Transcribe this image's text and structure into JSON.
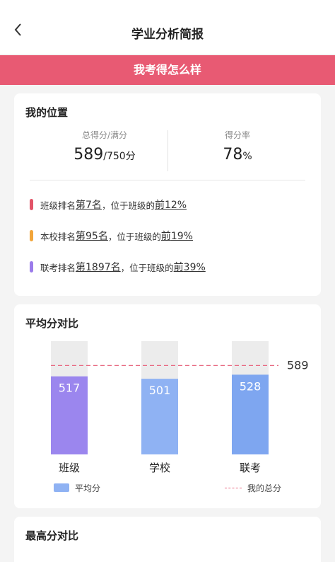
{
  "header": {
    "title": "学业分析简报",
    "back_icon": "chevron-left-icon"
  },
  "banner": {
    "text": "我考得怎么样"
  },
  "position_card": {
    "title": "我的位置",
    "score_label": "总得分/满分",
    "score": "589",
    "score_total": "/750分",
    "rate_label": "得分率",
    "rate": "78",
    "rate_unit": "%",
    "rankings": [
      {
        "color": "#e25468",
        "prefix": "班级排名",
        "rank_prefix": "第",
        "rank": "7名",
        "mid": "，位于班级的",
        "pct_prefix": "前",
        "pct": "12%"
      },
      {
        "color": "#f2a53a",
        "prefix": "本校排名",
        "rank_prefix": "第",
        "rank": "95名",
        "mid": "，位于班级的",
        "pct_prefix": "前",
        "pct": "19%"
      },
      {
        "color": "#9b7bea",
        "prefix": "联考排名",
        "rank_prefix": "第",
        "rank": "1897名",
        "mid": "，位于班级的",
        "pct_prefix": "前",
        "pct": "39%"
      }
    ]
  },
  "avg_card": {
    "title": "平均分对比",
    "legend_avg": "平均分",
    "legend_mine": "我的总分",
    "colors": {
      "bar_class": "#9b86ee",
      "bar_school": "#8fb2f3",
      "bar_joint": "#7ea6f0",
      "bg_bar": "#ececec",
      "my_line": "#e86b83"
    }
  },
  "chart_data": {
    "type": "bar",
    "categories": [
      "班级",
      "学校",
      "联考"
    ],
    "values": [
      517,
      501,
      528
    ],
    "my_total": 589,
    "ylim": [
      0,
      750
    ],
    "title": "平均分对比"
  },
  "max_card": {
    "title": "最高分对比"
  }
}
